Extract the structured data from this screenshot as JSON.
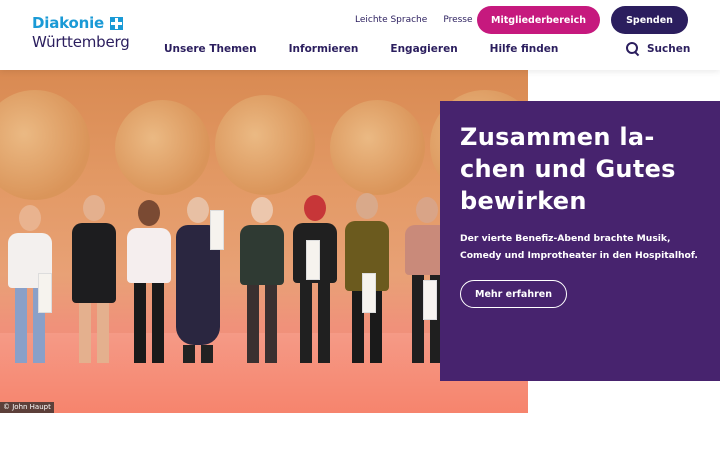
{
  "logo": {
    "line1": "Diakonie",
    "line2": "Württemberg"
  },
  "utility_links": [
    "Leichte Sprache",
    "Presse"
  ],
  "buttons": {
    "members": "Mitgliederbereich",
    "donate": "Spenden"
  },
  "main_nav": [
    "Unsere Themen",
    "Informieren",
    "Engagieren",
    "Hilfe finden"
  ],
  "search": {
    "label": "Suchen"
  },
  "hero": {
    "photo_credit": "© John Haupt",
    "title": "Zusammen la-chen und Gutes bewirken",
    "text": "Der vierte Benefiz-Abend brachte Musik, Comedy und Improtheater in den Hospitalhof.",
    "cta": "Mehr erfahren"
  },
  "colors": {
    "brand_blue": "#1a9ad6",
    "navy": "#2b1e5e",
    "magenta": "#c6197e",
    "purple_panel": "#47236e"
  }
}
